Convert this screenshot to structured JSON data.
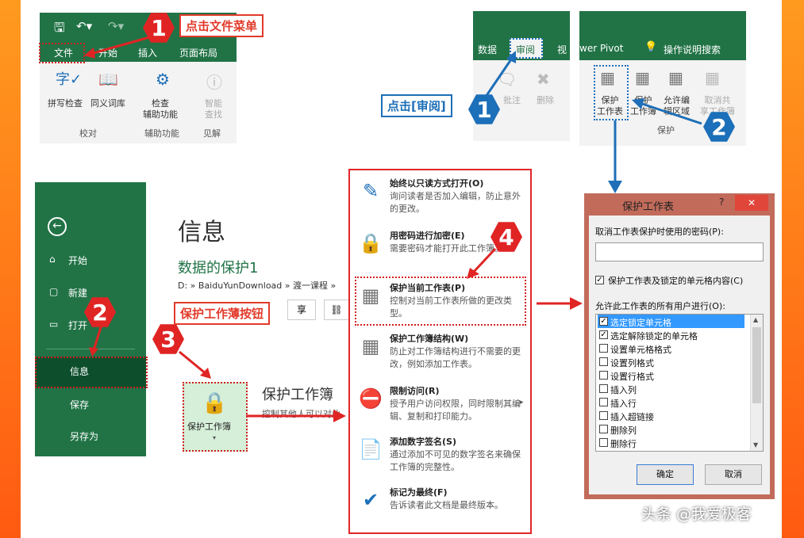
{
  "callouts": {
    "c1": "点击文件菜单",
    "c2": "点击[审阅]",
    "c3": "保护工作薄按钮"
  },
  "steps": {
    "s1": "1",
    "s1b": "1",
    "s2": "2",
    "s2b": "2",
    "s3": "3",
    "s4": "4"
  },
  "ribbon1": {
    "tabs": [
      "文件",
      "开始",
      "插入",
      "页面布局"
    ],
    "buttons": [
      "拼写检查",
      "同义词库",
      "检查\n辅助功能",
      "智能\n查找"
    ],
    "groups": [
      "校对",
      "辅助功能",
      "见解"
    ]
  },
  "ribbon2": {
    "tabs": [
      "数据",
      "审阅",
      "视"
    ],
    "buttons": [
      "批注",
      "删除"
    ]
  },
  "ribbon3": {
    "tabs": [
      "wer Pivot",
      "操作说明搜索"
    ],
    "buttons": [
      "保护\n工作表",
      "保护\n工作簿",
      "允许编\n辑区域",
      "取消共\n享工作簿"
    ],
    "group": "保护"
  },
  "backstage": {
    "nav": [
      "开始",
      "新建",
      "打开",
      "信息",
      "保存",
      "另存为"
    ],
    "title": "信息",
    "subtitle": "数据的保护1",
    "path": "D: » BaiduYunDownload » 渡一课程 »",
    "share": "享",
    "protect_btn": "保护工作簿",
    "protect_title": "保护工作簿",
    "protect_desc": "控制其他人可以对此"
  },
  "menu": {
    "items": [
      {
        "title": "始终以只读方式打开(O)",
        "desc": "询问读者是否加入编辑，防止意外的更改。"
      },
      {
        "title": "用密码进行加密(E)",
        "desc": "需要密码才能打开此工作簿。"
      },
      {
        "title": "保护当前工作表(P)",
        "desc": "控制对当前工作表所做的更改类型。"
      },
      {
        "title": "保护工作簿结构(W)",
        "desc": "防止对工作簿结构进行不需要的更改，例如添加工作表。"
      },
      {
        "title": "限制访问(R)",
        "desc": "授予用户访问权限，同时限制其编辑、复制和打印能力。"
      },
      {
        "title": "添加数字签名(S)",
        "desc": "通过添加不可见的数字签名来确保工作簿的完整性。"
      },
      {
        "title": "标记为最终(F)",
        "desc": "告诉读者此文档是最终版本。"
      }
    ]
  },
  "dialog": {
    "title": "保护工作表",
    "help": "?",
    "close": "✕",
    "pw_label": "取消工作表保护时使用的密码(P):",
    "protect_check": "保护工作表及锁定的单元格内容(C)",
    "allow_label": "允许此工作表的所有用户进行(O):",
    "options": [
      {
        "label": "选定锁定单元格",
        "checked": true
      },
      {
        "label": "选定解除锁定的单元格",
        "checked": true
      },
      {
        "label": "设置单元格格式",
        "checked": false
      },
      {
        "label": "设置列格式",
        "checked": false
      },
      {
        "label": "设置行格式",
        "checked": false
      },
      {
        "label": "插入列",
        "checked": false
      },
      {
        "label": "插入行",
        "checked": false
      },
      {
        "label": "插入超链接",
        "checked": false
      },
      {
        "label": "删除列",
        "checked": false
      },
      {
        "label": "删除行",
        "checked": false
      }
    ],
    "ok": "确定",
    "cancel": "取消"
  },
  "watermark": "头条 @我爱极客"
}
